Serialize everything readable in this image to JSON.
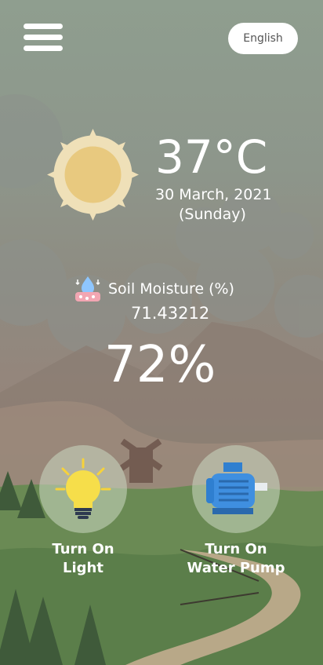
{
  "header": {
    "language_label": "English"
  },
  "weather": {
    "temperature": "37°C",
    "date": "30 March, 2021",
    "day": "(Sunday)"
  },
  "soil": {
    "label": "Soil Moisture (%)",
    "raw_value": "71.43212",
    "percent": "72%"
  },
  "controls": {
    "light_line1": "Turn On",
    "light_line2": "Light",
    "pump_line1": "Turn On",
    "pump_line2": "Water Pump"
  }
}
